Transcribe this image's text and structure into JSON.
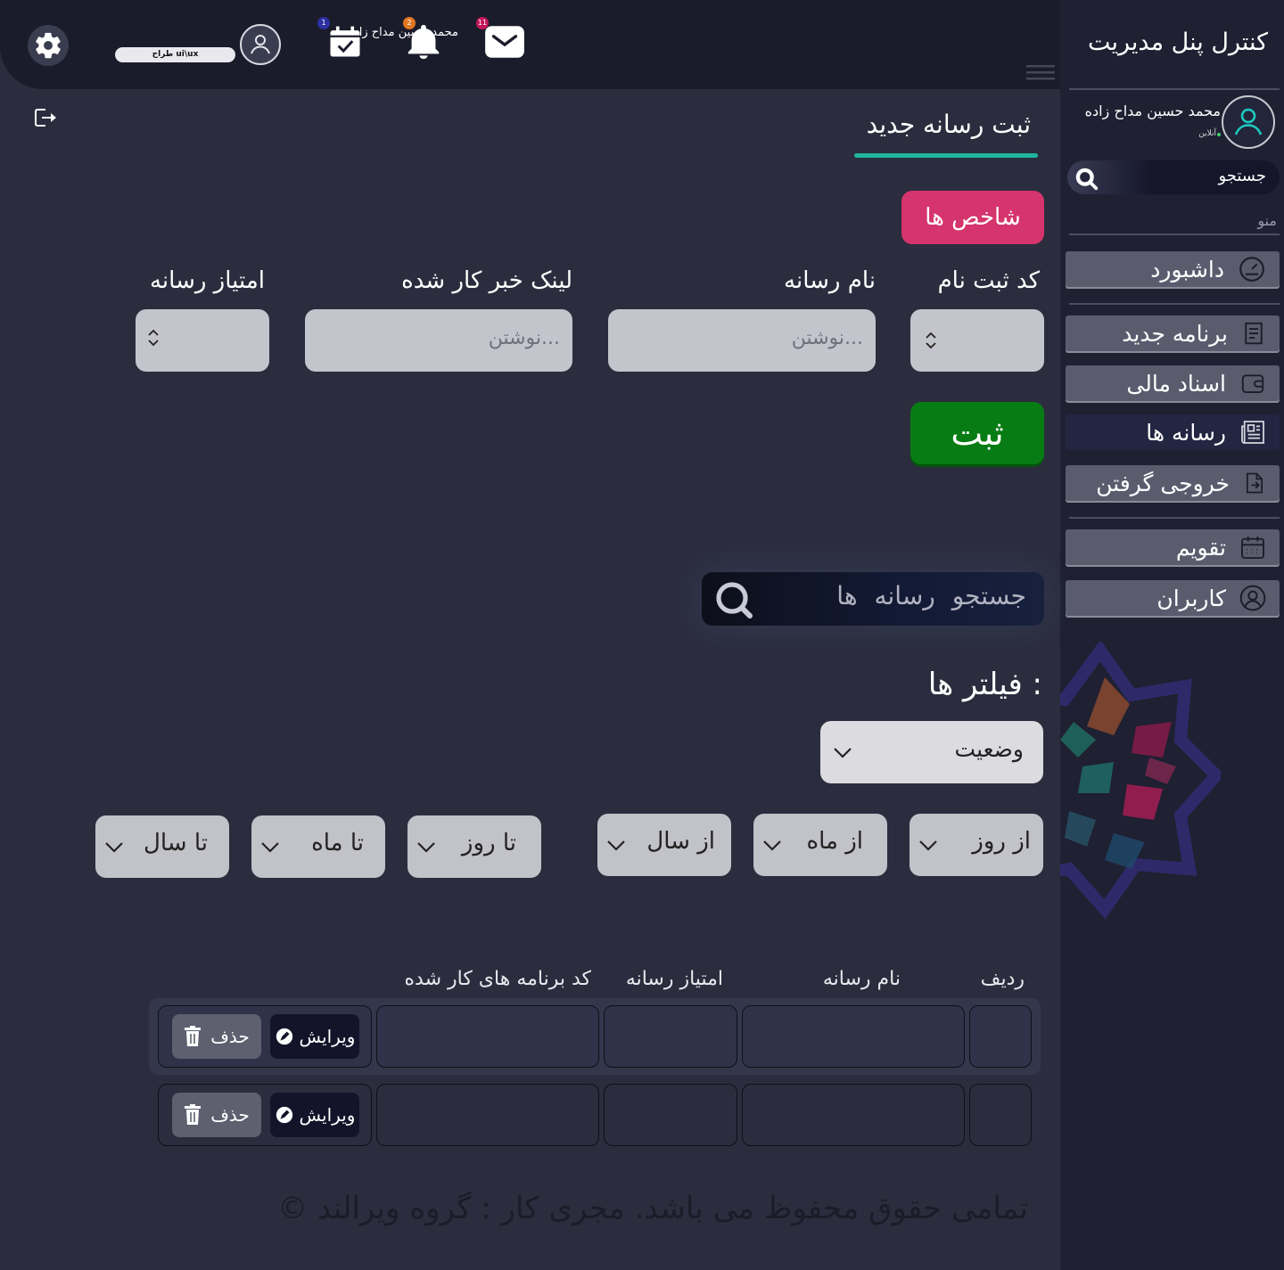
{
  "colors": {
    "accent_pink": "#d5346d",
    "accent_green": "#087c14",
    "accent_teal": "#1fb5a0",
    "sidebar_bg": "#1f2032",
    "main_bg": "#2b2d3e"
  },
  "header": {
    "user_name": "محمد حسین مداح زاده",
    "user_role": "طراح ui\\ux",
    "badges": {
      "tasks": "1",
      "notifications": "2",
      "messages": "11"
    },
    "icons": [
      "gear-icon",
      "user-icon",
      "calendar-check-icon",
      "bell-icon",
      "mail-icon",
      "hamburger-icon",
      "logout-icon"
    ]
  },
  "sidebar": {
    "title": "کنترل پنل مدیریت",
    "user_name": "محمد حسین مداح زاده",
    "status": "آنلاین",
    "search_label": "جستجو",
    "menu_label": "منو",
    "items": [
      {
        "label": "داشبورد",
        "icon": "dashboard-icon"
      },
      {
        "label": "برنامه جدید",
        "icon": "document-icon"
      },
      {
        "label": "اسناد مالی",
        "icon": "wallet-icon"
      },
      {
        "label": "رسانه ها",
        "icon": "newspaper-icon"
      },
      {
        "label": "خروجی گرفتن",
        "icon": "export-icon"
      },
      {
        "label": "تقویم",
        "icon": "calendar-icon"
      },
      {
        "label": "کاربران",
        "icon": "user-icon"
      }
    ],
    "active_index": 3
  },
  "main": {
    "title": "ثبت رسانه جدید",
    "indicators_button": "شاخص ها",
    "fields": {
      "code_label": "کد ثبت نام",
      "media_name_label": "نام رسانه",
      "media_name_placeholder": "نوشتن...",
      "news_link_label": "لینک خبر کار شده",
      "news_link_placeholder": "نوشتن...",
      "score_label": "امتیاز رسانه"
    },
    "submit_button": "ثبت",
    "media_search_label": "جستجو رسانه ها",
    "filters_title": "فیلتر ها :",
    "status_select": "وضعیت",
    "date_filters": [
      "از روز",
      "از ماه",
      "از سال",
      "تا روز",
      "تا ماه",
      "تا سال"
    ]
  },
  "table": {
    "headers": [
      "ردیف",
      "نام رسانه",
      "امتیاز رسانه",
      "کد برنامه های کار شده"
    ],
    "edit_label": "ویرایش",
    "delete_label": "حذف"
  },
  "footer": "© تمامی حقوق محفوظ می باشد. مجری کار : گروه ویرالند"
}
